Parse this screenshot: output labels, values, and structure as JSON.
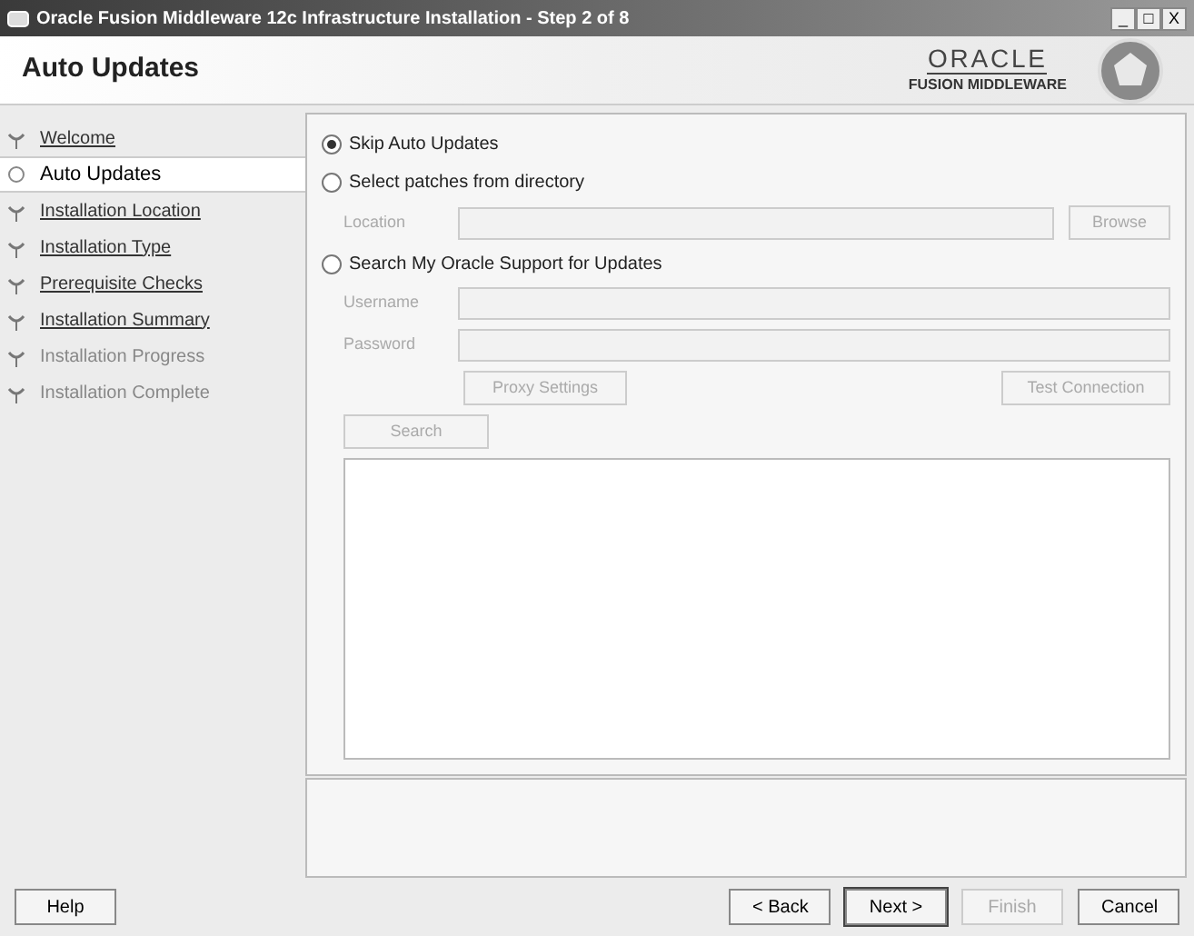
{
  "window": {
    "title": "Oracle Fusion Middleware 12c Infrastructure Installation - Step 2 of 8",
    "controls": [
      "_",
      "□",
      "X"
    ]
  },
  "header": {
    "title": "Auto Updates",
    "logo_top": "ORACLE",
    "logo_bottom": "FUSION MIDDLEWARE"
  },
  "steps": [
    {
      "label": "Welcome",
      "selected": false,
      "link": true
    },
    {
      "label": "Auto Updates",
      "selected": true,
      "link": false
    },
    {
      "label": "Installation Location",
      "selected": false,
      "link": true
    },
    {
      "label": "Installation Type",
      "selected": false,
      "link": true
    },
    {
      "label": "Prerequisite Checks",
      "selected": false,
      "link": true
    },
    {
      "label": "Installation Summary",
      "selected": false,
      "link": true
    },
    {
      "label": "Installation Progress",
      "selected": false,
      "link": false
    },
    {
      "label": "Installation Complete",
      "selected": false,
      "link": false
    }
  ],
  "options": [
    {
      "kind": "radio",
      "label": "Skip Auto Updates",
      "selected": true
    },
    {
      "kind": "radio",
      "label": "Select patches from directory",
      "selected": false
    },
    {
      "kind": "field",
      "label": "Location",
      "disabled": true,
      "button": "Browse"
    },
    {
      "kind": "radio",
      "label": "Search My Oracle Support for Updates",
      "selected": false
    },
    {
      "kind": "field",
      "label": "Username",
      "disabled": true
    },
    {
      "kind": "field",
      "label": "Password",
      "disabled": true
    },
    {
      "kind": "buttons",
      "left": "Proxy Settings",
      "right": "Test Connection",
      "disabled": true
    },
    {
      "kind": "search",
      "label": "Search",
      "disabled": true
    }
  ],
  "buttons": [
    {
      "label": "Help",
      "disabled": false
    },
    {
      "label": "< Back",
      "disabled": false
    },
    {
      "label": "Next >",
      "disabled": false,
      "default": true
    },
    {
      "label": "Finish",
      "disabled": true
    },
    {
      "label": "Cancel",
      "disabled": false
    }
  ]
}
